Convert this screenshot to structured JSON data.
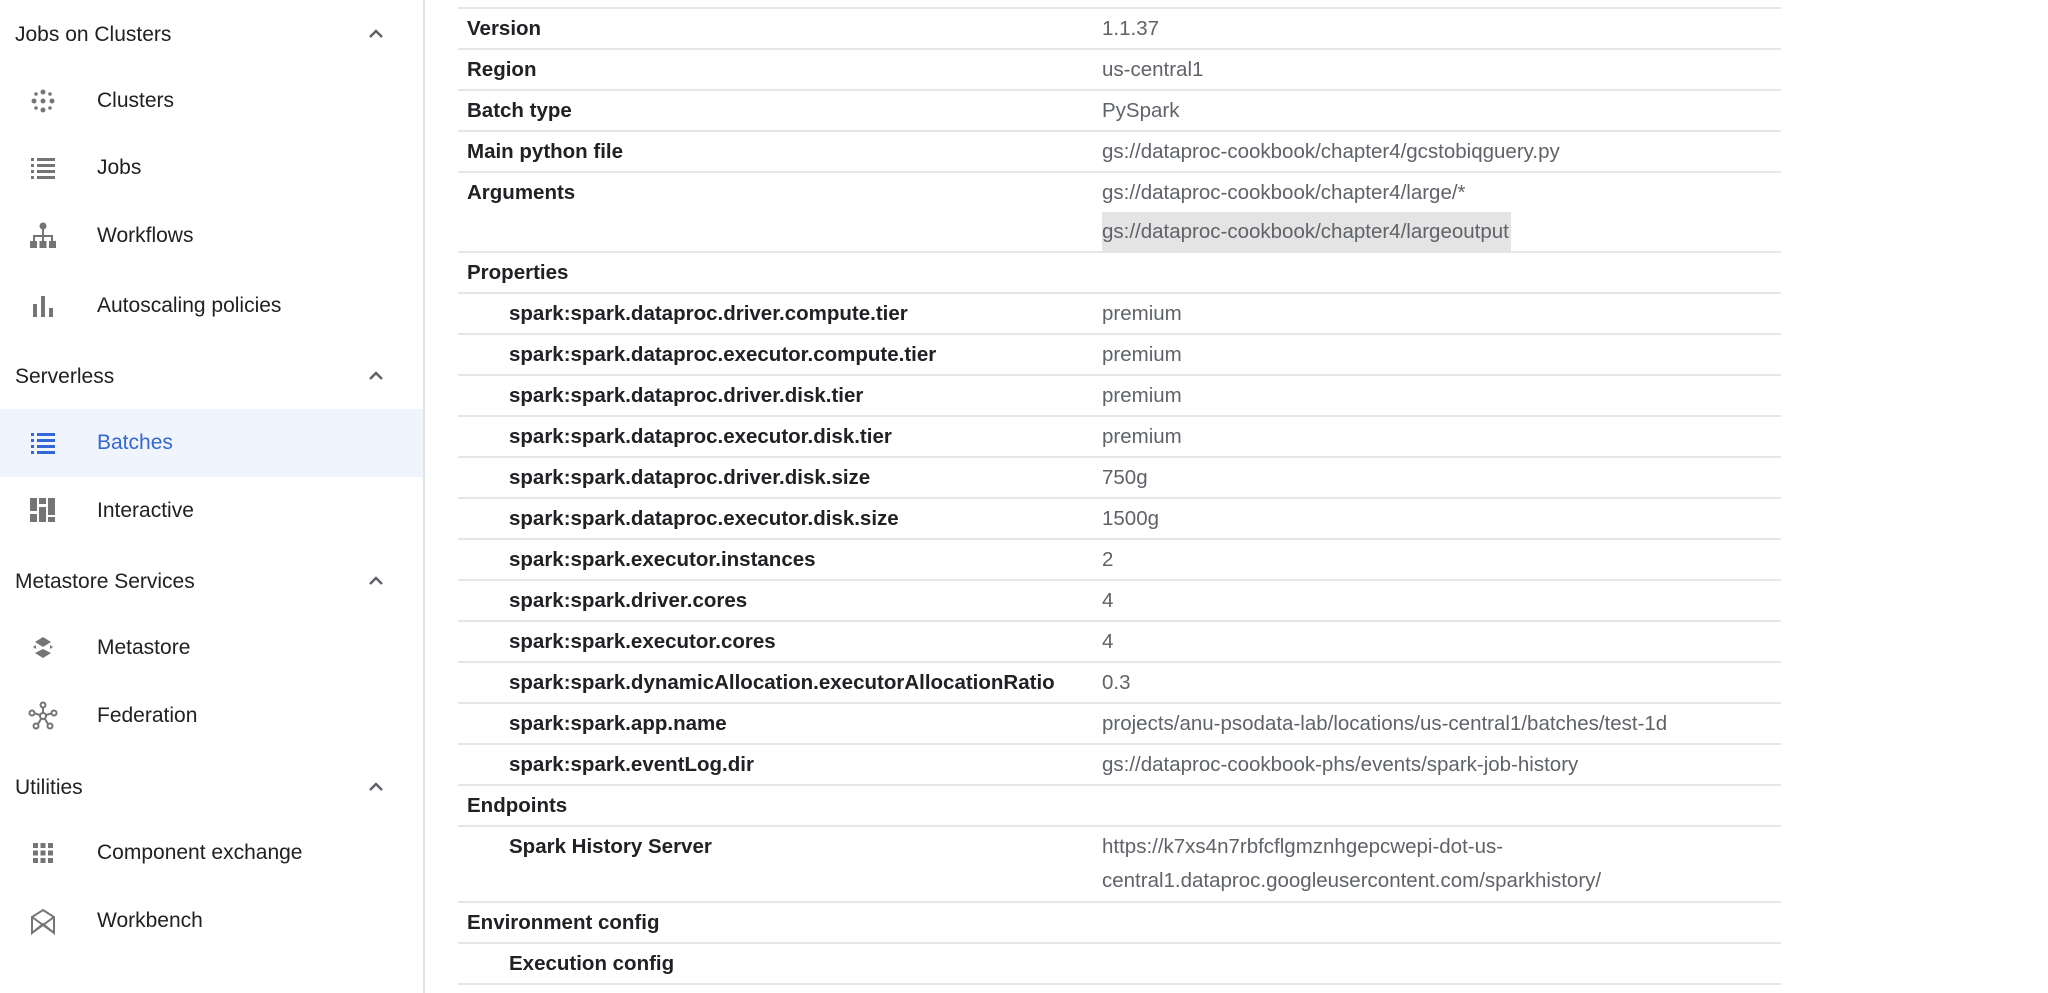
{
  "sidebar": {
    "sections": [
      {
        "title": "Jobs on Clusters",
        "items": [
          {
            "label": "Clusters",
            "icon": "clusters-icon"
          },
          {
            "label": "Jobs",
            "icon": "list-icon"
          },
          {
            "label": "Workflows",
            "icon": "workflow-icon"
          },
          {
            "label": "Autoscaling policies",
            "icon": "bar-chart-icon"
          }
        ]
      },
      {
        "title": "Serverless",
        "items": [
          {
            "label": "Batches",
            "icon": "list-icon",
            "active": true
          },
          {
            "label": "Interactive",
            "icon": "interactive-icon"
          }
        ]
      },
      {
        "title": "Metastore Services",
        "items": [
          {
            "label": "Metastore",
            "icon": "metastore-icon"
          },
          {
            "label": "Federation",
            "icon": "federation-icon"
          }
        ]
      },
      {
        "title": "Utilities",
        "items": [
          {
            "label": "Component exchange",
            "icon": "grid-icon"
          },
          {
            "label": "Workbench",
            "icon": "workbench-icon"
          }
        ]
      }
    ],
    "active_color": "#3367d6"
  },
  "details": {
    "rows": [
      {
        "key": "Version",
        "values": [
          "1.1.37"
        ]
      },
      {
        "key": "Region",
        "values": [
          "us-central1"
        ]
      },
      {
        "key": "Batch type",
        "values": [
          "PySpark"
        ]
      },
      {
        "key": "Main python file",
        "values": [
          "gs://dataproc-cookbook/chapter4/gcstobiqguery.py"
        ]
      },
      {
        "key": "Arguments",
        "values": [
          "gs://dataproc-cookbook/chapter4/large/*",
          "gs://dataproc-cookbook/chapter4/largeoutput"
        ],
        "highlighted": 1
      },
      {
        "key": "Properties",
        "values": []
      },
      {
        "key": "spark:spark.dataproc.driver.compute.tier",
        "values": [
          "premium"
        ],
        "indent": true
      },
      {
        "key": "spark:spark.dataproc.executor.compute.tier",
        "values": [
          "premium"
        ],
        "indent": true
      },
      {
        "key": "spark:spark.dataproc.driver.disk.tier",
        "values": [
          "premium"
        ],
        "indent": true
      },
      {
        "key": "spark:spark.dataproc.executor.disk.tier",
        "values": [
          "premium"
        ],
        "indent": true
      },
      {
        "key": "spark:spark.dataproc.driver.disk.size",
        "values": [
          "750g"
        ],
        "indent": true
      },
      {
        "key": "spark:spark.dataproc.executor.disk.size",
        "values": [
          "1500g"
        ],
        "indent": true
      },
      {
        "key": "spark:spark.executor.instances",
        "values": [
          "2"
        ],
        "indent": true
      },
      {
        "key": "spark:spark.driver.cores",
        "values": [
          "4"
        ],
        "indent": true
      },
      {
        "key": "spark:spark.executor.cores",
        "values": [
          "4"
        ],
        "indent": true
      },
      {
        "key": "spark:spark.dynamicAllocation.executorAllocationRatio",
        "values": [
          "0.3"
        ],
        "indent": true
      },
      {
        "key": "spark:spark.app.name",
        "values": [
          "projects/anu-psodata-lab/locations/us-central1/batches/test-1d"
        ],
        "indent": true
      },
      {
        "key": "spark:spark.eventLog.dir",
        "values": [
          "gs://dataproc-cookbook-phs/events/spark-job-history"
        ],
        "indent": true
      },
      {
        "key": "Endpoints",
        "values": []
      },
      {
        "key": "Spark History Server",
        "values": [
          "https://k7xs4n7rbfcflgmznhgepcwepi-dot-us-",
          "central1.dataproc.googleusercontent.com/sparkhistory/"
        ],
        "indent": true,
        "wrap": true
      },
      {
        "key": "Environment config",
        "values": []
      },
      {
        "key": "Execution config",
        "values": [],
        "indent": true
      }
    ]
  }
}
